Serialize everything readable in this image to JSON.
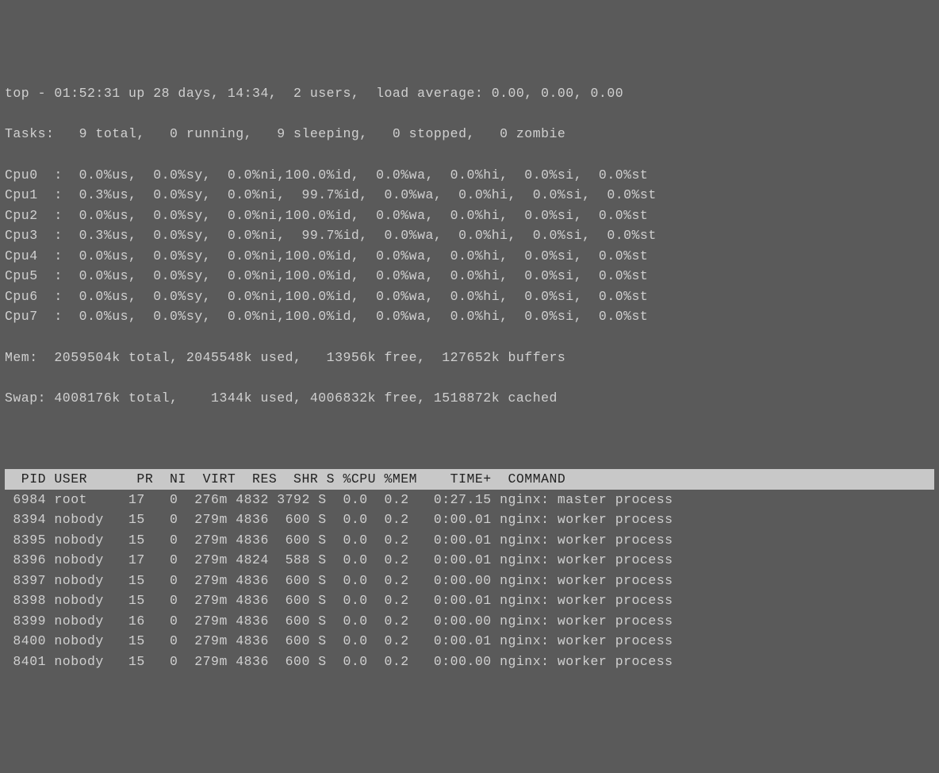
{
  "summary": {
    "line1": "top - 01:52:31 up 28 days, 14:34,  2 users,  load average: 0.00, 0.00, 0.00",
    "line2": "Tasks:   9 total,   0 running,   9 sleeping,   0 stopped,   0 zombie"
  },
  "cpus": [
    {
      "name": "Cpu0",
      "us": "0.0",
      "sy": "0.0",
      "ni": "0.0",
      "id": "100.0",
      "wa": "0.0",
      "hi": "0.0",
      "si": "0.0",
      "st": "0.0"
    },
    {
      "name": "Cpu1",
      "us": "0.3",
      "sy": "0.0",
      "ni": "0.0",
      "id": " 99.7",
      "wa": "0.0",
      "hi": "0.0",
      "si": "0.0",
      "st": "0.0"
    },
    {
      "name": "Cpu2",
      "us": "0.0",
      "sy": "0.0",
      "ni": "0.0",
      "id": "100.0",
      "wa": "0.0",
      "hi": "0.0",
      "si": "0.0",
      "st": "0.0"
    },
    {
      "name": "Cpu3",
      "us": "0.3",
      "sy": "0.0",
      "ni": "0.0",
      "id": " 99.7",
      "wa": "0.0",
      "hi": "0.0",
      "si": "0.0",
      "st": "0.0"
    },
    {
      "name": "Cpu4",
      "us": "0.0",
      "sy": "0.0",
      "ni": "0.0",
      "id": "100.0",
      "wa": "0.0",
      "hi": "0.0",
      "si": "0.0",
      "st": "0.0"
    },
    {
      "name": "Cpu5",
      "us": "0.0",
      "sy": "0.0",
      "ni": "0.0",
      "id": "100.0",
      "wa": "0.0",
      "hi": "0.0",
      "si": "0.0",
      "st": "0.0"
    },
    {
      "name": "Cpu6",
      "us": "0.0",
      "sy": "0.0",
      "ni": "0.0",
      "id": "100.0",
      "wa": "0.0",
      "hi": "0.0",
      "si": "0.0",
      "st": "0.0"
    },
    {
      "name": "Cpu7",
      "us": "0.0",
      "sy": "0.0",
      "ni": "0.0",
      "id": "100.0",
      "wa": "0.0",
      "hi": "0.0",
      "si": "0.0",
      "st": "0.0"
    }
  ],
  "mem": {
    "total": "2059504k",
    "used": "2045548k",
    "free": "13956k",
    "buffers": "127652k"
  },
  "swap": {
    "total": "4008176k",
    "used": "1344k",
    "free": "4006832k",
    "cached": "1518872k"
  },
  "columns": "  PID USER      PR  NI  VIRT  RES  SHR S %CPU %MEM    TIME+  COMMAND",
  "processes": [
    {
      "pid": "6984",
      "user": "root",
      "pr": "17",
      "ni": "0",
      "virt": "276m",
      "res": "4832",
      "shr": "3792",
      "s": "S",
      "cpu": "0.0",
      "mem": "0.2",
      "time": "0:27.15",
      "cmd": "nginx: master process"
    },
    {
      "pid": "8394",
      "user": "nobody",
      "pr": "15",
      "ni": "0",
      "virt": "279m",
      "res": "4836",
      "shr": "600",
      "s": "S",
      "cpu": "0.0",
      "mem": "0.2",
      "time": "0:00.01",
      "cmd": "nginx: worker process"
    },
    {
      "pid": "8395",
      "user": "nobody",
      "pr": "15",
      "ni": "0",
      "virt": "279m",
      "res": "4836",
      "shr": "600",
      "s": "S",
      "cpu": "0.0",
      "mem": "0.2",
      "time": "0:00.01",
      "cmd": "nginx: worker process"
    },
    {
      "pid": "8396",
      "user": "nobody",
      "pr": "17",
      "ni": "0",
      "virt": "279m",
      "res": "4824",
      "shr": "588",
      "s": "S",
      "cpu": "0.0",
      "mem": "0.2",
      "time": "0:00.01",
      "cmd": "nginx: worker process"
    },
    {
      "pid": "8397",
      "user": "nobody",
      "pr": "15",
      "ni": "0",
      "virt": "279m",
      "res": "4836",
      "shr": "600",
      "s": "S",
      "cpu": "0.0",
      "mem": "0.2",
      "time": "0:00.00",
      "cmd": "nginx: worker process"
    },
    {
      "pid": "8398",
      "user": "nobody",
      "pr": "15",
      "ni": "0",
      "virt": "279m",
      "res": "4836",
      "shr": "600",
      "s": "S",
      "cpu": "0.0",
      "mem": "0.2",
      "time": "0:00.01",
      "cmd": "nginx: worker process"
    },
    {
      "pid": "8399",
      "user": "nobody",
      "pr": "16",
      "ni": "0",
      "virt": "279m",
      "res": "4836",
      "shr": "600",
      "s": "S",
      "cpu": "0.0",
      "mem": "0.2",
      "time": "0:00.00",
      "cmd": "nginx: worker process"
    },
    {
      "pid": "8400",
      "user": "nobody",
      "pr": "15",
      "ni": "0",
      "virt": "279m",
      "res": "4836",
      "shr": "600",
      "s": "S",
      "cpu": "0.0",
      "mem": "0.2",
      "time": "0:00.01",
      "cmd": "nginx: worker process"
    },
    {
      "pid": "8401",
      "user": "nobody",
      "pr": "15",
      "ni": "0",
      "virt": "279m",
      "res": "4836",
      "shr": "600",
      "s": "S",
      "cpu": "0.0",
      "mem": "0.2",
      "time": "0:00.00",
      "cmd": "nginx: worker process"
    }
  ]
}
